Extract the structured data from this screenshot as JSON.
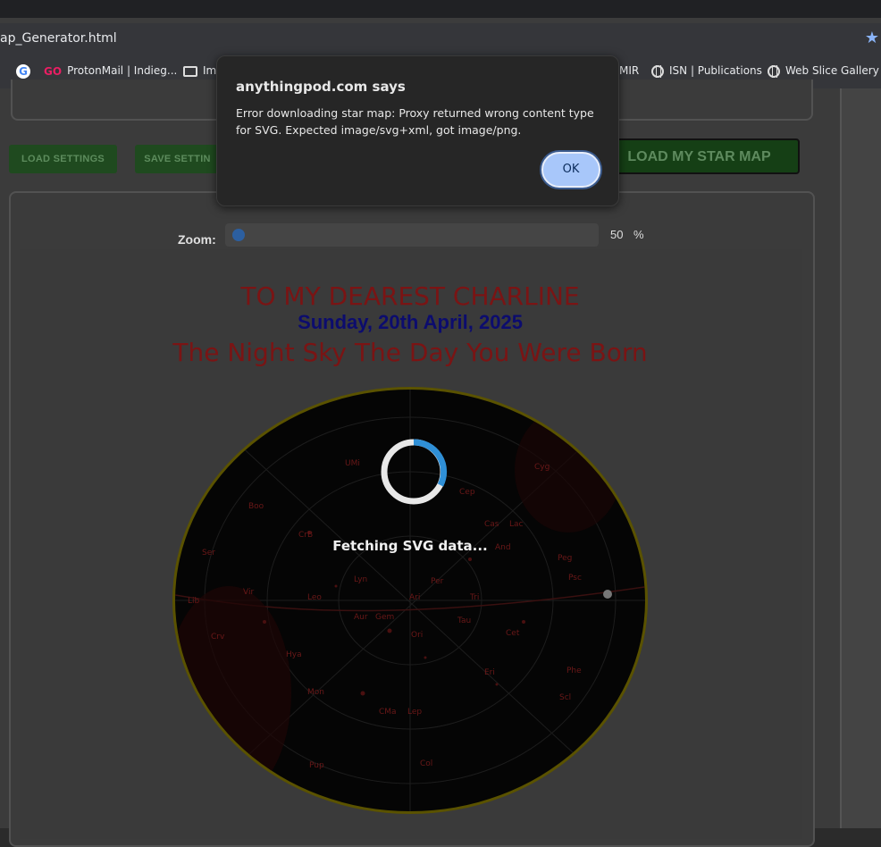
{
  "browser": {
    "url_fragment": "ap_Generator.html",
    "bookmarks": [
      {
        "label": "",
        "icon": "google-icon"
      },
      {
        "label": "ProtonMail | Indieg...",
        "icon": "go-icon"
      },
      {
        "label": "Im",
        "icon": "folder-icon"
      },
      {
        "label": "MIR",
        "icon": "none"
      },
      {
        "label": "ISN | Publications",
        "icon": "globe-icon"
      },
      {
        "label": "Web Slice Gallery",
        "icon": "globe-icon"
      }
    ]
  },
  "toolbar": {
    "load_settings": "LOAD SETTINGS",
    "save_settings": "SAVE SETTIN",
    "download": "LOAD MY STAR MAP"
  },
  "zoom": {
    "label": "Zoom:",
    "value": "50",
    "unit": "%",
    "fraction": 0.0
  },
  "poster": {
    "line1": "TO MY DEAREST CHARLINE",
    "line2": "Sunday, 20th April, 2025",
    "line3": "The Night Sky The Day You Were Born",
    "status": "Fetching SVG data...",
    "constellations": [
      "UMi",
      "Cyg",
      "Boo",
      "Cep",
      "Cas",
      "Lac",
      "CrB",
      "And",
      "Peg",
      "Ser",
      "Psc",
      "Per",
      "Vir",
      "Leo",
      "Lyn",
      "Ari",
      "Lib",
      "Tri",
      "Crv",
      "Aur",
      "Tau",
      "Cet",
      "Gem",
      "Ori",
      "Hya",
      "Eri",
      "Mon",
      "CMa",
      "Lep",
      "Col",
      "Pup",
      "Scl",
      "Phe"
    ]
  },
  "dialog": {
    "title": "anythingpod.com says",
    "message": "Error downloading star map: Proxy returned wrong content type for SVG. Expected image/svg+xml, got image/png.",
    "ok": "OK"
  },
  "colors": {
    "title_red": "#7a1414",
    "date_blue": "#0c0c6e",
    "button_green": "#1f4a1f",
    "ok_blue": "#a8c7fa"
  }
}
